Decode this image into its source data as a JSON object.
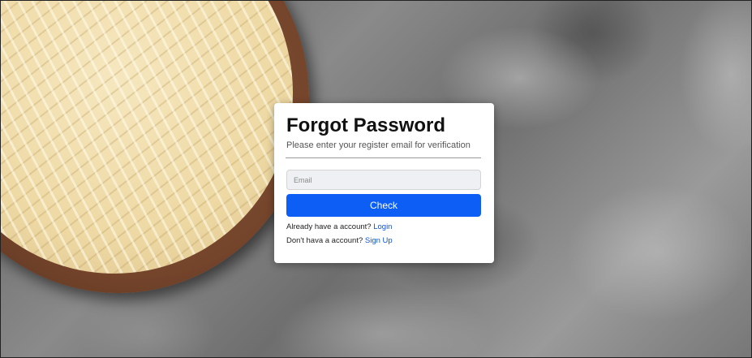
{
  "forgot_password": {
    "title": "Forgot Password",
    "subtitle": "Please enter your register email for verification",
    "email_placeholder": "Email",
    "email_value": "",
    "check_label": "Check",
    "login_prompt": "Already have a account?",
    "login_link": "Login",
    "signup_prompt": "Don't hava a account?",
    "signup_link": "Sign Up"
  },
  "colors": {
    "primary_button": "#0d5ef5",
    "link": "#0b54d6",
    "card_background": "#ffffff"
  }
}
